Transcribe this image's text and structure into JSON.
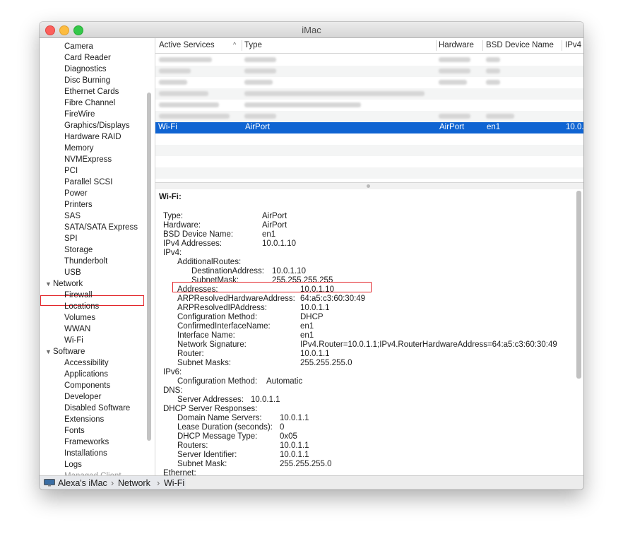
{
  "window": {
    "title": "iMac"
  },
  "sidebar": {
    "items": [
      {
        "label": "Camera",
        "type": "item"
      },
      {
        "label": "Card Reader",
        "type": "item"
      },
      {
        "label": "Diagnostics",
        "type": "item"
      },
      {
        "label": "Disc Burning",
        "type": "item"
      },
      {
        "label": "Ethernet Cards",
        "type": "item"
      },
      {
        "label": "Fibre Channel",
        "type": "item"
      },
      {
        "label": "FireWire",
        "type": "item"
      },
      {
        "label": "Graphics/Displays",
        "type": "item"
      },
      {
        "label": "Hardware RAID",
        "type": "item"
      },
      {
        "label": "Memory",
        "type": "item"
      },
      {
        "label": "NVMExpress",
        "type": "item"
      },
      {
        "label": "PCI",
        "type": "item"
      },
      {
        "label": "Parallel SCSI",
        "type": "item"
      },
      {
        "label": "Power",
        "type": "item"
      },
      {
        "label": "Printers",
        "type": "item"
      },
      {
        "label": "SAS",
        "type": "item"
      },
      {
        "label": "SATA/SATA Express",
        "type": "item"
      },
      {
        "label": "SPI",
        "type": "item"
      },
      {
        "label": "Storage",
        "type": "item"
      },
      {
        "label": "Thunderbolt",
        "type": "item"
      },
      {
        "label": "USB",
        "type": "item"
      },
      {
        "label": "Network",
        "type": "group",
        "disclosure": "▼",
        "highlighted": true
      },
      {
        "label": "Firewall",
        "type": "item"
      },
      {
        "label": "Locations",
        "type": "item"
      },
      {
        "label": "Volumes",
        "type": "item"
      },
      {
        "label": "WWAN",
        "type": "item"
      },
      {
        "label": "Wi-Fi",
        "type": "item"
      },
      {
        "label": "Software",
        "type": "group",
        "disclosure": "▼"
      },
      {
        "label": "Accessibility",
        "type": "item"
      },
      {
        "label": "Applications",
        "type": "item"
      },
      {
        "label": "Components",
        "type": "item"
      },
      {
        "label": "Developer",
        "type": "item"
      },
      {
        "label": "Disabled Software",
        "type": "item"
      },
      {
        "label": "Extensions",
        "type": "item"
      },
      {
        "label": "Fonts",
        "type": "item"
      },
      {
        "label": "Frameworks",
        "type": "item"
      },
      {
        "label": "Installations",
        "type": "item"
      },
      {
        "label": "Logs",
        "type": "item"
      }
    ]
  },
  "table": {
    "columns": [
      "Active Services",
      "Type",
      "Hardware",
      "BSD Device Name",
      "IPv4"
    ],
    "sort_indicator": "^",
    "selected_row": {
      "active_service": "Wi-Fi",
      "type": "AirPort",
      "hardware": "AirPort",
      "bsd_device_name": "en1",
      "ipv4": "10.0."
    }
  },
  "detail": {
    "heading": "Wi-Fi:",
    "lines": [
      {
        "key": "Type:",
        "value": "AirPort"
      },
      {
        "key": "Hardware:",
        "value": "AirPort"
      },
      {
        "key": "BSD Device Name:",
        "value": "en1"
      },
      {
        "key": "IPv4 Addresses:",
        "value": "10.0.1.10"
      },
      {
        "key": "IPv4:",
        "value": ""
      },
      {
        "key": "AdditionalRoutes:",
        "value": ""
      },
      {
        "key": "DestinationAddress:",
        "value": "10.0.1.10"
      },
      {
        "key": "SubnetMask:",
        "value": "255.255.255.255"
      },
      {
        "key": "Addresses:",
        "value": "10.0.1.10"
      },
      {
        "key": "ARPResolvedHardwareAddress:",
        "value": "64:a5:c3:60:30:49"
      },
      {
        "key": "ARPResolvedIPAddress:",
        "value": "10.0.1.1"
      },
      {
        "key": "Configuration Method:",
        "value": "DHCP"
      },
      {
        "key": "ConfirmedInterfaceName:",
        "value": "en1"
      },
      {
        "key": "Interface Name:",
        "value": "en1"
      },
      {
        "key": "Network Signature:",
        "value": "IPv4.Router=10.0.1.1;IPv4.RouterHardwareAddress=64:a5:c3:60:30:49"
      },
      {
        "key": "Router:",
        "value": "10.0.1.1"
      },
      {
        "key": "Subnet Masks:",
        "value": "255.255.255.0"
      },
      {
        "key": "IPv6:",
        "value": ""
      },
      {
        "key": "Configuration Method:",
        "value": "Automatic"
      },
      {
        "key": "DNS:",
        "value": ""
      },
      {
        "key": "Server Addresses:",
        "value": "10.0.1.1"
      },
      {
        "key": "DHCP Server Responses:",
        "value": ""
      },
      {
        "key": "Domain Name Servers:",
        "value": "10.0.1.1"
      },
      {
        "key": "Lease Duration (seconds):",
        "value": "0"
      },
      {
        "key": "DHCP Message Type:",
        "value": "0x05"
      },
      {
        "key": "Routers:",
        "value": "10.0.1.1"
      },
      {
        "key": "Server Identifier:",
        "value": "10.0.1.1"
      },
      {
        "key": "Subnet Mask:",
        "value": "255.255.255.0"
      },
      {
        "key": "Ethernet:",
        "value": ""
      }
    ]
  },
  "statusbar": {
    "computer_name": "Alexa's iMac",
    "separator": "›",
    "crumbs": [
      "Network",
      "Wi-Fi"
    ]
  },
  "colors": {
    "selection": "#0f64d2",
    "highlight_box": "#e2262b"
  }
}
